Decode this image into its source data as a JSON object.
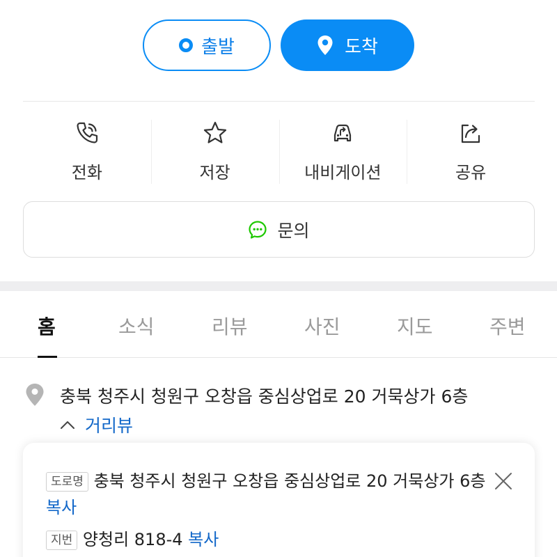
{
  "route": {
    "depart_label": "출발",
    "arrive_label": "도착"
  },
  "actions": [
    {
      "label": "전화",
      "icon": "phone-icon"
    },
    {
      "label": "저장",
      "icon": "star-icon"
    },
    {
      "label": "내비게이션",
      "icon": "navigation-car-icon"
    },
    {
      "label": "공유",
      "icon": "share-icon"
    }
  ],
  "inquiry": {
    "label": "문의",
    "icon": "chat-bubble-icon"
  },
  "tabs": [
    "홈",
    "소식",
    "리뷰",
    "사진",
    "지도",
    "주변"
  ],
  "active_tab": "홈",
  "address": {
    "full": "충북 청주시 청원구 오창읍 중심상업로 20 거묵상가 6층",
    "street_view_label": "거리뷰"
  },
  "address_detail": {
    "road_badge": "도로명",
    "road_address": "충북 청주시 청원구 오창읍 중심상업로 20 거묵상가 6층",
    "lot_badge": "지번",
    "lot_address": "양청리 818-4",
    "copy_label": "복사"
  },
  "colors": {
    "accent": "#0a8cf5",
    "link": "#1368c9",
    "inquiry_green": "#1ec800"
  }
}
